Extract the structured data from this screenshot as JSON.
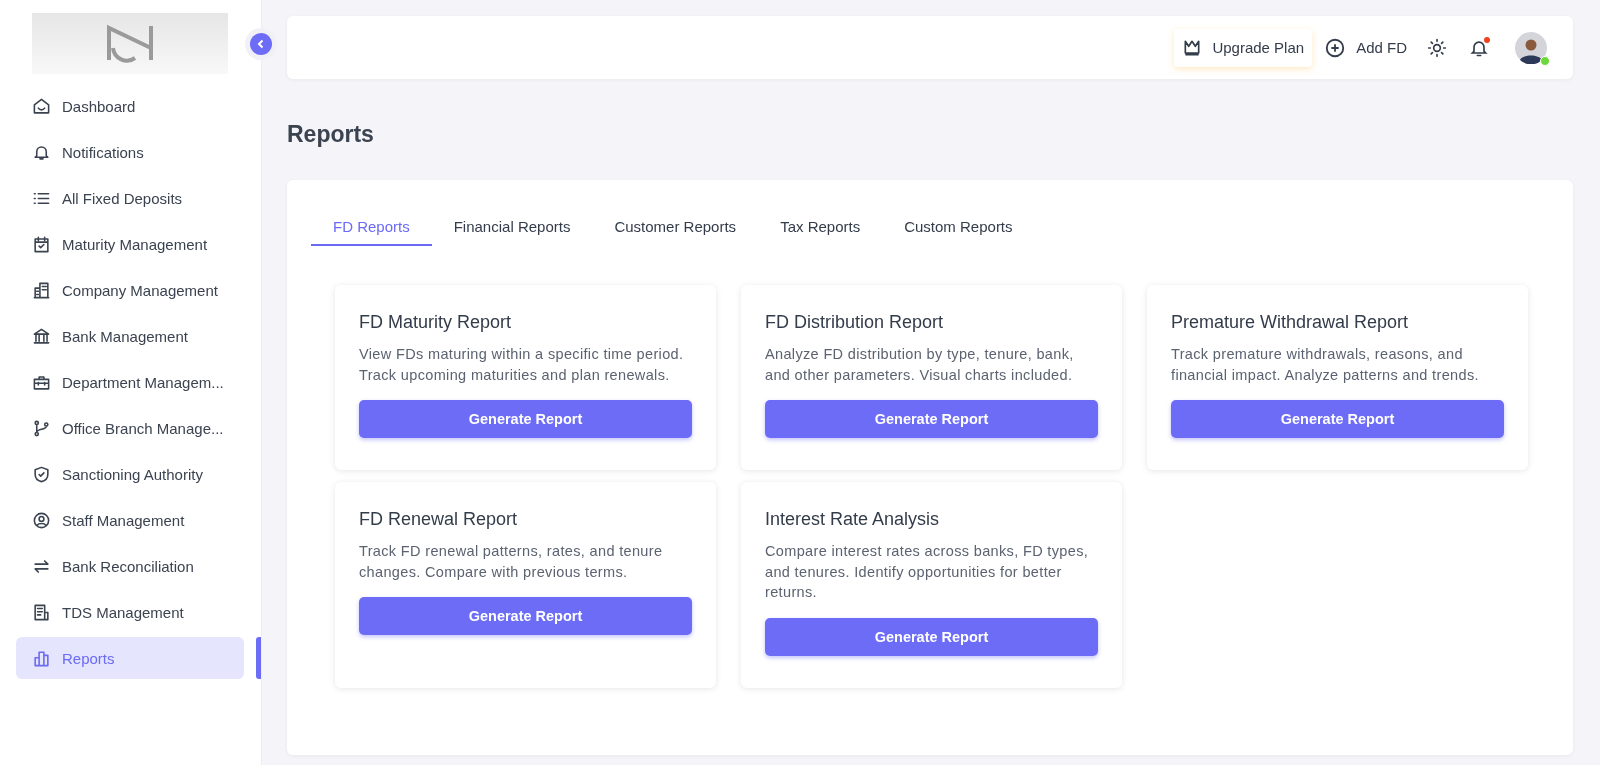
{
  "sidebar": {
    "items": [
      {
        "label": "Dashboard",
        "selected": false
      },
      {
        "label": "Notifications",
        "selected": false
      },
      {
        "label": "All Fixed Deposits",
        "selected": false
      },
      {
        "label": "Maturity Management",
        "selected": false
      },
      {
        "label": "Company Management",
        "selected": false
      },
      {
        "label": "Bank Management",
        "selected": false
      },
      {
        "label": "Department Managem...",
        "selected": false
      },
      {
        "label": "Office Branch Manage...",
        "selected": false
      },
      {
        "label": "Sanctioning Authority",
        "selected": false
      },
      {
        "label": "Staff Management",
        "selected": false
      },
      {
        "label": "Bank Reconciliation",
        "selected": false
      },
      {
        "label": "TDS Management",
        "selected": false
      },
      {
        "label": "Reports",
        "selected": true
      }
    ]
  },
  "topbar": {
    "upgrade": "Upgrade Plan",
    "add": "Add FD",
    "notifications_unread": true,
    "user_online": true
  },
  "page_title": "Reports",
  "tabs": [
    {
      "label": "FD Reports",
      "selected": true
    },
    {
      "label": "Financial Reports",
      "selected": false
    },
    {
      "label": "Customer Reports",
      "selected": false
    },
    {
      "label": "Tax Reports",
      "selected": false
    },
    {
      "label": "Custom Reports",
      "selected": false
    }
  ],
  "reports": [
    {
      "title": "FD Maturity Report",
      "description": "View FDs maturing within a specific time period. Track upcoming maturities and plan renewals.",
      "button": "Generate Report"
    },
    {
      "title": "FD Distribution Report",
      "description": "Analyze FD distribution by type, tenure, bank, and other parameters. Visual charts included.",
      "button": "Generate Report"
    },
    {
      "title": "Premature Withdrawal Report",
      "description": "Track premature withdrawals, reasons, and financial impact. Analyze patterns and trends.",
      "button": "Generate Report"
    },
    {
      "title": "FD Renewal Report",
      "description": "Track FD renewal patterns, rates, and tenure changes. Compare with previous terms.",
      "button": "Generate Report"
    },
    {
      "title": "Interest Rate Analysis",
      "description": "Compare interest rates across banks, FD types, and tenures. Identify opportunities for better returns.",
      "button": "Generate Report"
    }
  ]
}
